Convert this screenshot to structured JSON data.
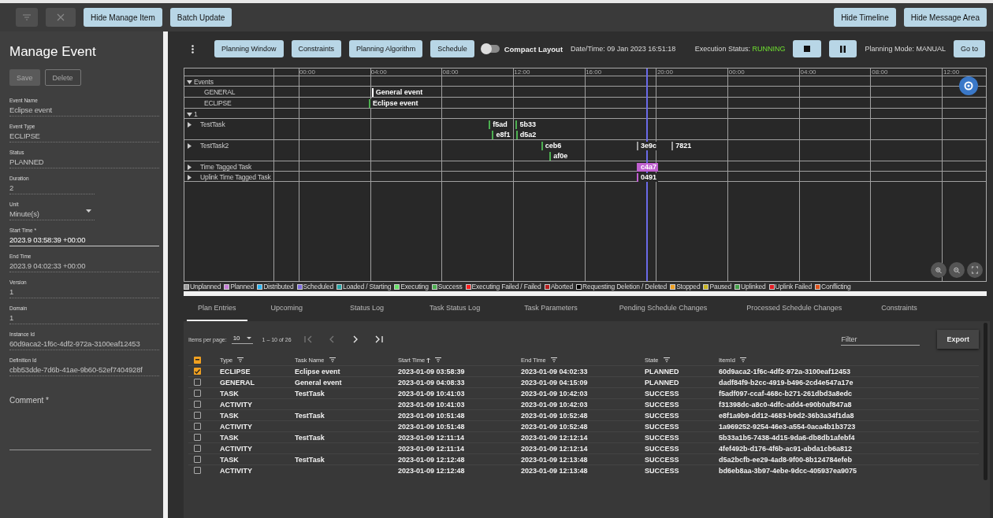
{
  "top_bar": {
    "icon_buttons": [
      {
        "disabled": true
      },
      {
        "disabled": true
      }
    ],
    "left_buttons": [
      "Hide Manage Item",
      "Batch Update"
    ],
    "right_buttons": [
      "Hide Timeline",
      "Hide Message Area"
    ]
  },
  "manage_panel": {
    "title": "Manage Event",
    "actions": [
      {
        "label": "Save",
        "kind": "filled",
        "disabled": true
      },
      {
        "label": "Delete",
        "kind": "outlined",
        "disabled": true
      }
    ],
    "fields": [
      {
        "label": "Event Name",
        "value": "Eclipse event",
        "kind": "text",
        "focused": false
      },
      {
        "label": "Event Type",
        "value": "ECLIPSE",
        "kind": "text",
        "focused": false
      },
      {
        "label": "Status",
        "value": "PLANNED",
        "kind": "text",
        "focused": false
      },
      {
        "label": "Duration",
        "value": "2",
        "kind": "short",
        "focused": false
      },
      {
        "label": "Unit",
        "value": "Minute(s)",
        "kind": "select",
        "focused": false
      },
      {
        "label": "Start Time *",
        "value": "2023.9 03:58:39 +00:00",
        "kind": "text",
        "focused": true
      },
      {
        "label": "End Time",
        "value": "2023.9 04:02:33 +00:00",
        "kind": "text",
        "focused": false
      },
      {
        "label": "Version",
        "value": "1",
        "kind": "text",
        "focused": false
      },
      {
        "label": "Domain",
        "value": "1",
        "kind": "text",
        "focused": false
      },
      {
        "label": "Instance Id",
        "value": "60d9aca2-1f6c-4df2-972a-3100eaf12453",
        "kind": "text",
        "focused": false
      },
      {
        "label": "Definition Id",
        "value": "cbb53dde-7d6b-41ae-9b60-52ef7404928f",
        "kind": "text",
        "focused": false
      }
    ],
    "comment": {
      "label": "Comment *"
    }
  },
  "toolbar": {
    "buttons": [
      "Planning Window",
      "Constraints",
      "Planning Algorithm",
      "Schedule"
    ],
    "compact_layout": {
      "label": "Compact Layout",
      "on": false
    },
    "datetime": "Date/Time: 09 Jan 2023 16:51:18",
    "execution_status": {
      "label": "Execution Status:",
      "value": "RUNNING"
    },
    "planning_mode": "Planning Mode: MANUAL",
    "goto": "Go to"
  },
  "timeline": {
    "time_labels": [
      "00:00",
      "04:00",
      "08:00",
      "12:00",
      "16:00",
      "20:00",
      "00:00",
      "04:00",
      "08:00",
      "12:00"
    ],
    "rows": [
      {
        "label": "Events",
        "kind": "group",
        "expanded": true
      },
      {
        "label": "GENERAL",
        "kind": "category",
        "lanes": [
          [
            {
              "label": "General event",
              "color": "#ffffff",
              "selected": false
            }
          ]
        ]
      },
      {
        "label": "ECLIPSE",
        "kind": "category",
        "lanes": [
          [
            {
              "label": "Eclipse event",
              "color": "#4caf50",
              "selected": false
            }
          ]
        ]
      },
      {
        "label": "1",
        "kind": "group",
        "expanded": true
      },
      {
        "label": "TestTask",
        "kind": "task",
        "expanded": false,
        "lanes": [
          [
            {
              "label": "f5ad",
              "color": "#4caf50",
              "selected": false
            },
            {
              "label": "5b33",
              "color": "#4caf50",
              "selected": false
            }
          ],
          [
            {
              "label": "e8f1",
              "color": "#4caf50",
              "selected": false
            },
            {
              "label": "d5a2",
              "color": "#4caf50",
              "selected": false
            }
          ]
        ]
      },
      {
        "label": "TestTask2",
        "kind": "task",
        "expanded": false,
        "lanes": [
          [
            {
              "label": "ceb6",
              "color": "#4caf50",
              "selected": false
            },
            {
              "label": "3e9c",
              "color": "#9e9e9e",
              "selected": false
            },
            {
              "label": "7821",
              "color": "#9e9e9e",
              "selected": false
            }
          ],
          [
            {
              "label": "af0e",
              "color": "#4caf50",
              "selected": false
            }
          ]
        ]
      },
      {
        "label": "Time Tagged Task",
        "kind": "task",
        "expanded": false,
        "lanes": [
          [
            {
              "label": "c4a7",
              "color": "#c060d0",
              "selected": true
            }
          ]
        ]
      },
      {
        "label": "Uplink Time Tagged Task",
        "kind": "task",
        "expanded": false,
        "lanes": [
          [
            {
              "label": "0491",
              "color": "#c060d0",
              "selected": false
            }
          ]
        ]
      }
    ]
  },
  "legend": [
    {
      "label": "Unplanned",
      "color": "#9e9e9e"
    },
    {
      "label": "Planned",
      "color": "#c77dd8"
    },
    {
      "label": "Distributed",
      "color": "#29b6f6"
    },
    {
      "label": "Scheduled",
      "color": "#7e6ee0"
    },
    {
      "label": "Loaded / Starting",
      "color": "#26a6a6"
    },
    {
      "label": "Executing",
      "color": "#66e066"
    },
    {
      "label": "Success",
      "color": "#4caf50"
    },
    {
      "label": "Executing Failed / Failed",
      "color": "#ff1f1f"
    },
    {
      "label": "Aborted",
      "color": "#b71c1c"
    },
    {
      "label": "Requesting Deletion / Deleted",
      "color": "#000000"
    },
    {
      "label": "Stopped",
      "color": "#f0a020"
    },
    {
      "label": "Paused",
      "color": "#c8b41e"
    },
    {
      "label": "Uplinked",
      "color": "#43a047"
    },
    {
      "label": "Uplink Failed",
      "color": "#e51c23"
    },
    {
      "label": "Conflicting",
      "color": "#e0531c"
    }
  ],
  "tabs": [
    {
      "label": "Plan Entries",
      "selected": true
    },
    {
      "label": "Upcoming",
      "selected": false
    },
    {
      "label": "Status Log",
      "selected": false
    },
    {
      "label": "Task Status Log",
      "selected": false
    },
    {
      "label": "Task Parameters",
      "selected": false
    },
    {
      "label": "Pending Schedule Changes",
      "selected": false
    },
    {
      "label": "Processed Schedule Changes",
      "selected": false
    },
    {
      "label": "Constraints",
      "selected": false
    }
  ],
  "table": {
    "pagination": {
      "items_per_page_label": "Items per page:",
      "items_per_page": "10",
      "range": "1 – 10 of 26"
    },
    "filter": {
      "placeholder": "Filter"
    },
    "export": "Export",
    "header_checkbox": {
      "partial": true
    },
    "columns": [
      {
        "label": "Type",
        "sorted": false
      },
      {
        "label": "Task Name",
        "sorted": false
      },
      {
        "label": "Start Time",
        "sorted": true
      },
      {
        "label": "End Time",
        "sorted": false
      },
      {
        "label": "State",
        "sorted": false
      },
      {
        "label": "ItemId",
        "sorted": false
      }
    ],
    "rows": [
      {
        "selected": true,
        "cells": [
          "ECLIPSE",
          "Eclipse event",
          "2023-01-09 03:58:39",
          "2023-01-09 04:02:33",
          "PLANNED",
          "60d9aca2-1f6c-4df2-972a-3100eaf12453"
        ]
      },
      {
        "selected": false,
        "cells": [
          "GENERAL",
          "General event",
          "2023-01-09 04:08:33",
          "2023-01-09 04:15:09",
          "PLANNED",
          "dadf84f9-b2cc-4919-b496-2cd4e547a17e"
        ]
      },
      {
        "selected": false,
        "cells": [
          "TASK",
          "TestTask",
          "2023-01-09 10:41:03",
          "2023-01-09 10:42:03",
          "SUCCESS",
          "f5adf097-ccaf-468c-b271-261dbd3a8edc"
        ]
      },
      {
        "selected": false,
        "cells": [
          "ACTIVITY",
          "",
          "2023-01-09 10:41:03",
          "2023-01-09 10:42:03",
          "SUCCESS",
          "f31398dc-a8c0-4dfc-add4-e90b0af847a8"
        ]
      },
      {
        "selected": false,
        "cells": [
          "TASK",
          "TestTask",
          "2023-01-09 10:51:48",
          "2023-01-09 10:52:48",
          "SUCCESS",
          "e8f1a9b9-dd12-4683-b9d2-36b3a34f1da8"
        ]
      },
      {
        "selected": false,
        "cells": [
          "ACTIVITY",
          "",
          "2023-01-09 10:51:48",
          "2023-01-09 10:52:48",
          "SUCCESS",
          "1a969252-9254-46e3-a554-0aca4b1b3723"
        ]
      },
      {
        "selected": false,
        "cells": [
          "TASK",
          "TestTask",
          "2023-01-09 12:11:14",
          "2023-01-09 12:12:14",
          "SUCCESS",
          "5b33a1b5-7438-4d15-9da6-db8db1afebf4"
        ]
      },
      {
        "selected": false,
        "cells": [
          "ACTIVITY",
          "",
          "2023-01-09 12:11:14",
          "2023-01-09 12:12:14",
          "SUCCESS",
          "4fef492b-d176-4f6b-ac91-abda1cb6a812"
        ]
      },
      {
        "selected": false,
        "cells": [
          "TASK",
          "TestTask",
          "2023-01-09 12:12:48",
          "2023-01-09 12:13:48",
          "SUCCESS",
          "d5a2bcfb-ee29-4ad8-9f00-8b124784efeb"
        ]
      },
      {
        "selected": false,
        "cells": [
          "ACTIVITY",
          "",
          "2023-01-09 12:12:48",
          "2023-01-09 12:13:48",
          "SUCCESS",
          "bd6eb8aa-3b97-4ebe-9dcc-405937ea9075"
        ]
      }
    ]
  }
}
